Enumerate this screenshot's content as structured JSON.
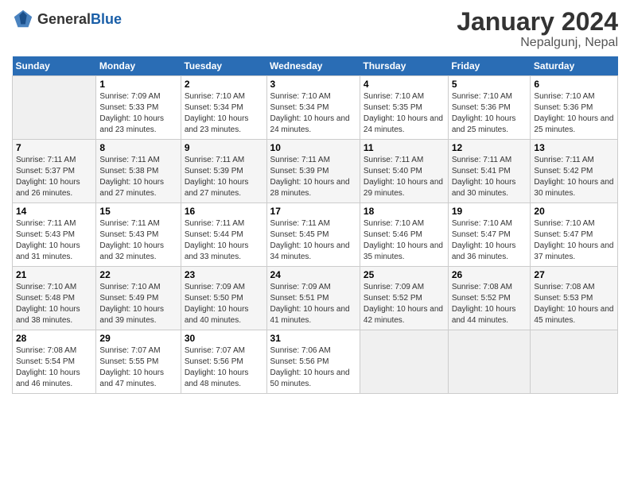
{
  "header": {
    "logo_general": "General",
    "logo_blue": "Blue",
    "title": "January 2024",
    "subtitle": "Nepalgunj, Nepal"
  },
  "days_of_week": [
    "Sunday",
    "Monday",
    "Tuesday",
    "Wednesday",
    "Thursday",
    "Friday",
    "Saturday"
  ],
  "weeks": [
    [
      {
        "day": "",
        "sunrise": "",
        "sunset": "",
        "daylight": ""
      },
      {
        "day": "1",
        "sunrise": "Sunrise: 7:09 AM",
        "sunset": "Sunset: 5:33 PM",
        "daylight": "Daylight: 10 hours and 23 minutes."
      },
      {
        "day": "2",
        "sunrise": "Sunrise: 7:10 AM",
        "sunset": "Sunset: 5:34 PM",
        "daylight": "Daylight: 10 hours and 23 minutes."
      },
      {
        "day": "3",
        "sunrise": "Sunrise: 7:10 AM",
        "sunset": "Sunset: 5:34 PM",
        "daylight": "Daylight: 10 hours and 24 minutes."
      },
      {
        "day": "4",
        "sunrise": "Sunrise: 7:10 AM",
        "sunset": "Sunset: 5:35 PM",
        "daylight": "Daylight: 10 hours and 24 minutes."
      },
      {
        "day": "5",
        "sunrise": "Sunrise: 7:10 AM",
        "sunset": "Sunset: 5:36 PM",
        "daylight": "Daylight: 10 hours and 25 minutes."
      },
      {
        "day": "6",
        "sunrise": "Sunrise: 7:10 AM",
        "sunset": "Sunset: 5:36 PM",
        "daylight": "Daylight: 10 hours and 25 minutes."
      }
    ],
    [
      {
        "day": "7",
        "sunrise": "Sunrise: 7:11 AM",
        "sunset": "Sunset: 5:37 PM",
        "daylight": "Daylight: 10 hours and 26 minutes."
      },
      {
        "day": "8",
        "sunrise": "Sunrise: 7:11 AM",
        "sunset": "Sunset: 5:38 PM",
        "daylight": "Daylight: 10 hours and 27 minutes."
      },
      {
        "day": "9",
        "sunrise": "Sunrise: 7:11 AM",
        "sunset": "Sunset: 5:39 PM",
        "daylight": "Daylight: 10 hours and 27 minutes."
      },
      {
        "day": "10",
        "sunrise": "Sunrise: 7:11 AM",
        "sunset": "Sunset: 5:39 PM",
        "daylight": "Daylight: 10 hours and 28 minutes."
      },
      {
        "day": "11",
        "sunrise": "Sunrise: 7:11 AM",
        "sunset": "Sunset: 5:40 PM",
        "daylight": "Daylight: 10 hours and 29 minutes."
      },
      {
        "day": "12",
        "sunrise": "Sunrise: 7:11 AM",
        "sunset": "Sunset: 5:41 PM",
        "daylight": "Daylight: 10 hours and 30 minutes."
      },
      {
        "day": "13",
        "sunrise": "Sunrise: 7:11 AM",
        "sunset": "Sunset: 5:42 PM",
        "daylight": "Daylight: 10 hours and 30 minutes."
      }
    ],
    [
      {
        "day": "14",
        "sunrise": "Sunrise: 7:11 AM",
        "sunset": "Sunset: 5:43 PM",
        "daylight": "Daylight: 10 hours and 31 minutes."
      },
      {
        "day": "15",
        "sunrise": "Sunrise: 7:11 AM",
        "sunset": "Sunset: 5:43 PM",
        "daylight": "Daylight: 10 hours and 32 minutes."
      },
      {
        "day": "16",
        "sunrise": "Sunrise: 7:11 AM",
        "sunset": "Sunset: 5:44 PM",
        "daylight": "Daylight: 10 hours and 33 minutes."
      },
      {
        "day": "17",
        "sunrise": "Sunrise: 7:11 AM",
        "sunset": "Sunset: 5:45 PM",
        "daylight": "Daylight: 10 hours and 34 minutes."
      },
      {
        "day": "18",
        "sunrise": "Sunrise: 7:10 AM",
        "sunset": "Sunset: 5:46 PM",
        "daylight": "Daylight: 10 hours and 35 minutes."
      },
      {
        "day": "19",
        "sunrise": "Sunrise: 7:10 AM",
        "sunset": "Sunset: 5:47 PM",
        "daylight": "Daylight: 10 hours and 36 minutes."
      },
      {
        "day": "20",
        "sunrise": "Sunrise: 7:10 AM",
        "sunset": "Sunset: 5:47 PM",
        "daylight": "Daylight: 10 hours and 37 minutes."
      }
    ],
    [
      {
        "day": "21",
        "sunrise": "Sunrise: 7:10 AM",
        "sunset": "Sunset: 5:48 PM",
        "daylight": "Daylight: 10 hours and 38 minutes."
      },
      {
        "day": "22",
        "sunrise": "Sunrise: 7:10 AM",
        "sunset": "Sunset: 5:49 PM",
        "daylight": "Daylight: 10 hours and 39 minutes."
      },
      {
        "day": "23",
        "sunrise": "Sunrise: 7:09 AM",
        "sunset": "Sunset: 5:50 PM",
        "daylight": "Daylight: 10 hours and 40 minutes."
      },
      {
        "day": "24",
        "sunrise": "Sunrise: 7:09 AM",
        "sunset": "Sunset: 5:51 PM",
        "daylight": "Daylight: 10 hours and 41 minutes."
      },
      {
        "day": "25",
        "sunrise": "Sunrise: 7:09 AM",
        "sunset": "Sunset: 5:52 PM",
        "daylight": "Daylight: 10 hours and 42 minutes."
      },
      {
        "day": "26",
        "sunrise": "Sunrise: 7:08 AM",
        "sunset": "Sunset: 5:52 PM",
        "daylight": "Daylight: 10 hours and 44 minutes."
      },
      {
        "day": "27",
        "sunrise": "Sunrise: 7:08 AM",
        "sunset": "Sunset: 5:53 PM",
        "daylight": "Daylight: 10 hours and 45 minutes."
      }
    ],
    [
      {
        "day": "28",
        "sunrise": "Sunrise: 7:08 AM",
        "sunset": "Sunset: 5:54 PM",
        "daylight": "Daylight: 10 hours and 46 minutes."
      },
      {
        "day": "29",
        "sunrise": "Sunrise: 7:07 AM",
        "sunset": "Sunset: 5:55 PM",
        "daylight": "Daylight: 10 hours and 47 minutes."
      },
      {
        "day": "30",
        "sunrise": "Sunrise: 7:07 AM",
        "sunset": "Sunset: 5:56 PM",
        "daylight": "Daylight: 10 hours and 48 minutes."
      },
      {
        "day": "31",
        "sunrise": "Sunrise: 7:06 AM",
        "sunset": "Sunset: 5:56 PM",
        "daylight": "Daylight: 10 hours and 50 minutes."
      },
      {
        "day": "",
        "sunrise": "",
        "sunset": "",
        "daylight": ""
      },
      {
        "day": "",
        "sunrise": "",
        "sunset": "",
        "daylight": ""
      },
      {
        "day": "",
        "sunrise": "",
        "sunset": "",
        "daylight": ""
      }
    ]
  ]
}
